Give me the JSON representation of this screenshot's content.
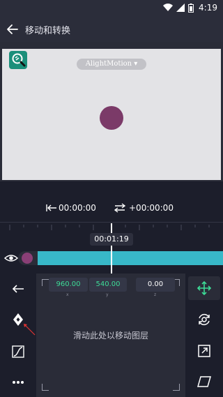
{
  "status_bar": {
    "time": "4:19",
    "icons": [
      "wifi-icon",
      "signal-icon",
      "battery-icon"
    ]
  },
  "app_bar": {
    "title": "移动和转换",
    "back_icon": "back-arrow-icon"
  },
  "preview": {
    "watermark": "AlightMotion ▾"
  },
  "timing": {
    "start_time": "00:00:00",
    "relative_time": "+00:00:00",
    "playhead_time": "00:01:19"
  },
  "transform_panel": {
    "x_value": "960.00",
    "x_label": "x",
    "y_value": "540.00",
    "y_label": "y",
    "z_value": "0.00",
    "z_label": "z",
    "hint": "滑动此处以移动图层"
  },
  "colors": {
    "accent": "#38b8c8",
    "value_green": "#3ddc97",
    "layer_color": "#7b3a68",
    "background": "#1c1e2b"
  }
}
